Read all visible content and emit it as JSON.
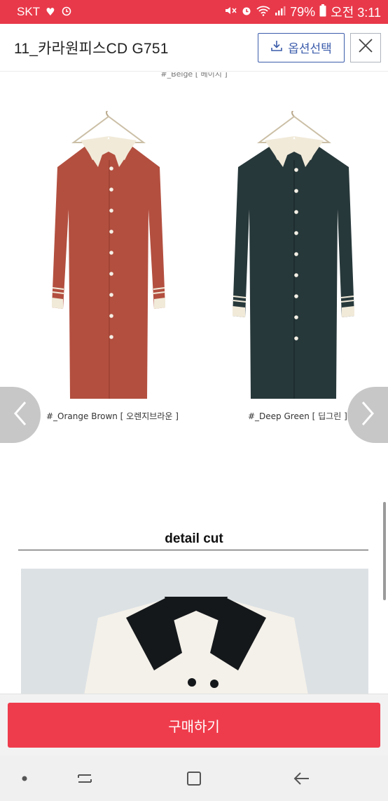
{
  "status_bar": {
    "carrier": "SKT",
    "battery": "79%",
    "time": "오전 3:11",
    "icons": [
      "heart-icon",
      "alarm-icon",
      "mute-icon",
      "alarm-icon",
      "wifi-icon",
      "signal-icon",
      "battery-icon"
    ]
  },
  "header": {
    "title": "11_카라원피스CD G751",
    "option_button_label": "옵션선택",
    "option_icon": "download-icon",
    "close_icon": "close-icon"
  },
  "content": {
    "top_caption": "#_Beige [ 베이지 ]",
    "products": [
      {
        "caption": "#_Orange Brown [ 오렌지브라운 ]",
        "color": "#b34f3f"
      },
      {
        "caption": "#_Deep Green [ 딥그린 ]",
        "color": "#27383a"
      }
    ],
    "section_title": "detail cut",
    "carousel": {
      "prev_icon": "chevron-left-icon",
      "next_icon": "chevron-right-icon"
    }
  },
  "buy_bar": {
    "buy_label": "구매하기"
  },
  "nav_bar": {
    "icons": [
      "dot-icon",
      "recent-apps-icon",
      "home-icon",
      "back-icon"
    ]
  },
  "colors": {
    "accent": "#ef3c4c",
    "status_bar": "#e8394a",
    "option_blue": "#3c5dab"
  }
}
